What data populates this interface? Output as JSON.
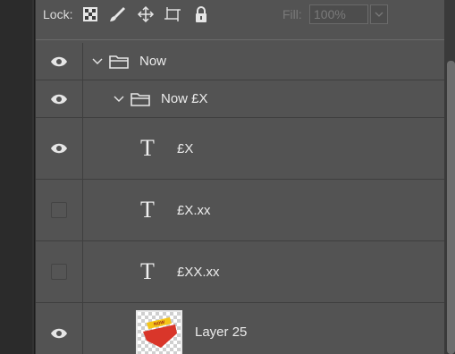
{
  "lock_bar": {
    "label": "Lock:",
    "icons": [
      "lock-transparent-pixels-icon",
      "lock-image-pixels-icon",
      "lock-position-icon",
      "lock-artboard-icon",
      "lock-all-icon"
    ],
    "fill_label": "Fill:",
    "fill_value": "100%"
  },
  "layers": [
    {
      "name": "Now",
      "type": "group",
      "visible": true,
      "expanded": true
    },
    {
      "name": "Now £X",
      "type": "group",
      "visible": true,
      "expanded": true
    },
    {
      "name": "£X",
      "type": "text",
      "visible": true
    },
    {
      "name": "£X.xx",
      "type": "text",
      "visible": false
    },
    {
      "name": "£XX.xx",
      "type": "text",
      "visible": false
    },
    {
      "name": "Layer 25",
      "type": "pixel",
      "visible": true,
      "thumbnail_badge": "NOW"
    }
  ],
  "text_layer_glyph": "T",
  "colors": {
    "panel_bg": "#535353",
    "row_divider": "#3f3f3f",
    "thumbnail_red": "#d9362a",
    "thumbnail_yellow": "#f5c518"
  }
}
